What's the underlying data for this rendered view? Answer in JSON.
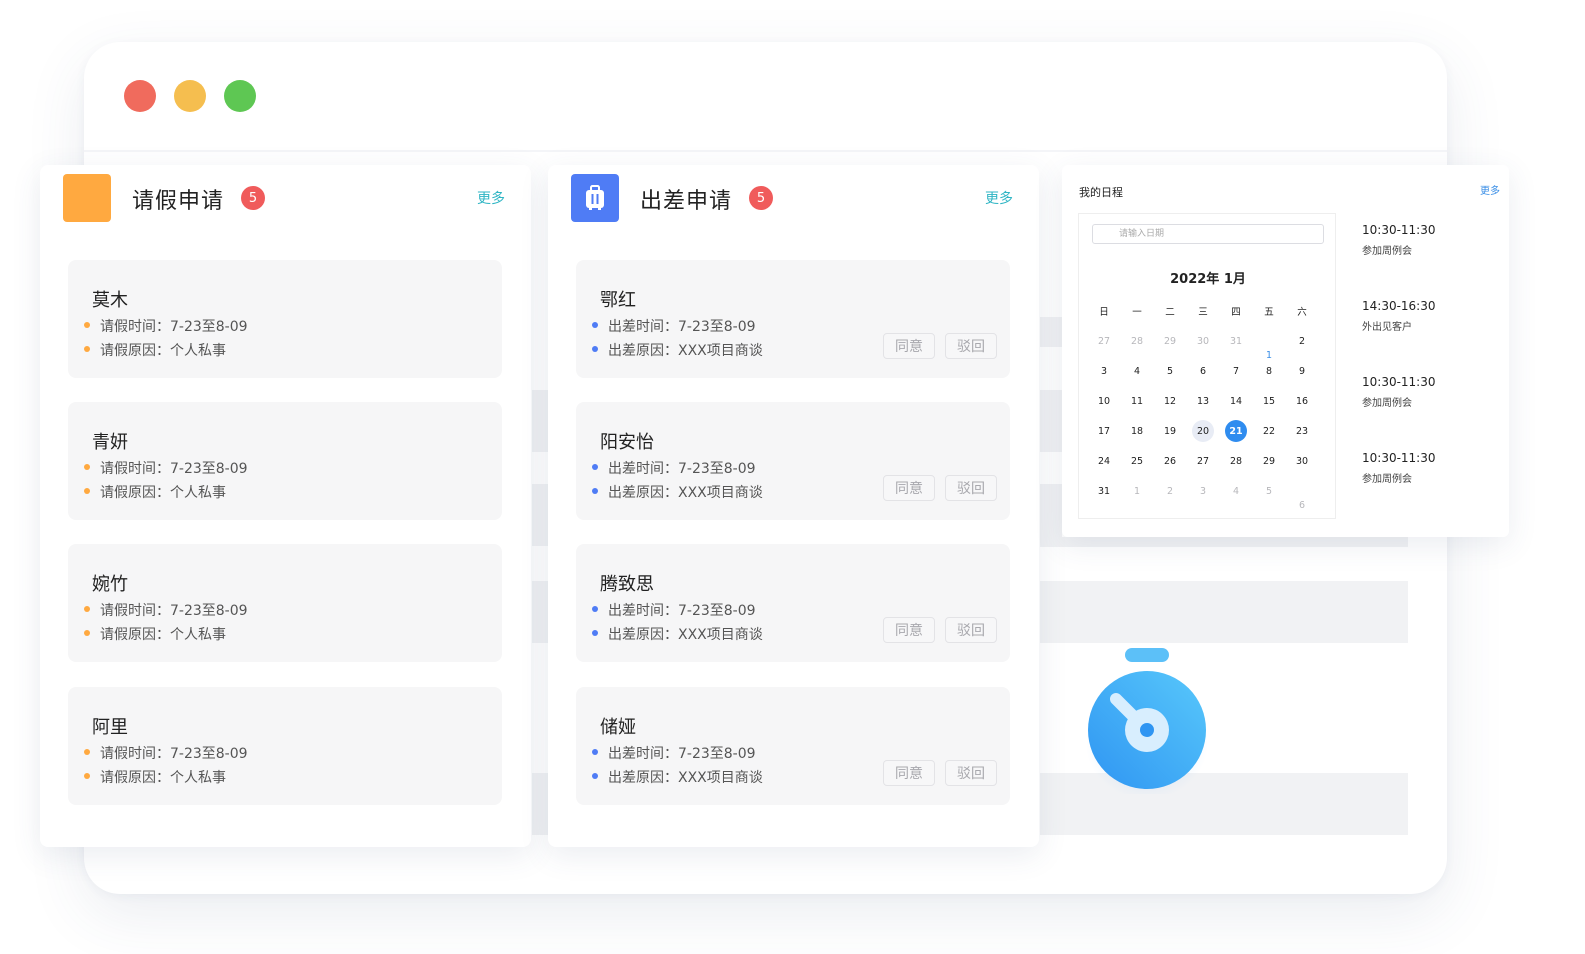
{
  "window": {
    "controls": [
      "close",
      "minimize",
      "maximize"
    ]
  },
  "leave_panel": {
    "title": "请假申请",
    "badge": "5",
    "more": "更多",
    "accent": "#ffa940",
    "items": [
      {
        "name": "莫木",
        "time": "请假时间：7-23至8-09",
        "reason": "请假原因：个人私事"
      },
      {
        "name": "青妍",
        "time": "请假时间：7-23至8-09",
        "reason": "请假原因：个人私事"
      },
      {
        "name": "婉竹",
        "time": "请假时间：7-23至8-09",
        "reason": "请假原因：个人私事"
      },
      {
        "name": "阿里",
        "time": "请假时间：7-23至8-09",
        "reason": "请假原因：个人私事"
      }
    ]
  },
  "trip_panel": {
    "title": "出差申请",
    "badge": "5",
    "more": "更多",
    "accent": "#4f7cf5",
    "icon": "suitcase-icon",
    "agree_label": "同意",
    "reject_label": "驳回",
    "items": [
      {
        "name": "鄂红",
        "time": "出差时间：7-23至8-09",
        "reason": "出差原因：XXX项目商谈"
      },
      {
        "name": "阳安怡",
        "time": "出差时间：7-23至8-09",
        "reason": "出差原因：XXX项目商谈"
      },
      {
        "name": "腾致思",
        "time": "出差时间：7-23至8-09",
        "reason": "出差原因：XXX项目商谈"
      },
      {
        "name": "储娅",
        "time": "出差时间：7-23至8-09",
        "reason": "出差原因：XXX项目商谈"
      }
    ]
  },
  "schedule": {
    "title": "我的日程",
    "more": "更多",
    "date_placeholder": "请输入日期",
    "month_label": "2022年  1月",
    "weekdays": [
      "日",
      "一",
      "二",
      "三",
      "四",
      "五",
      "六"
    ],
    "days": [
      [
        "27",
        "28",
        "29",
        "30",
        "31",
        "1",
        "2"
      ],
      [
        "3",
        "4",
        "5",
        "6",
        "7",
        "8",
        "9"
      ],
      [
        "10",
        "11",
        "12",
        "13",
        "14",
        "15",
        "16"
      ],
      [
        "17",
        "18",
        "19",
        "20",
        "21",
        "22",
        "23"
      ],
      [
        "24",
        "25",
        "26",
        "27",
        "28",
        "29",
        "30"
      ],
      [
        "31",
        "1",
        "2",
        "3",
        "4",
        "5",
        "6"
      ]
    ],
    "today": "20",
    "selected": "21",
    "events": [
      {
        "time": "10:30-11:30",
        "title": "参加周例会"
      },
      {
        "time": "14:30-16:30",
        "title": "外出见客户"
      },
      {
        "time": "10:30-11:30",
        "title": "参加周例会"
      },
      {
        "time": "10:30-11:30",
        "title": "参加周例会"
      }
    ]
  },
  "decor": {
    "stopwatch_icon": "stopwatch-icon",
    "stopwatch_color": "#3ba6f5"
  }
}
